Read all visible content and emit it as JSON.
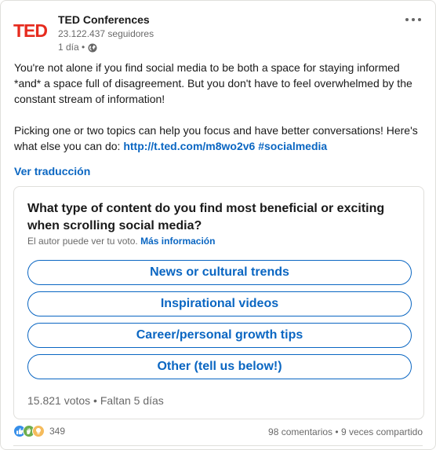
{
  "actor": {
    "logo_text": "TED",
    "name": "TED Conferences",
    "followers": "23.122.437 seguidores",
    "time": "1 día •"
  },
  "commentary": {
    "paragraph1": "You're not alone if you find social media to be both a space for staying informed *and* a space full of disagreement. But you don't have to feel overwhelmed by the constant stream of information!",
    "paragraph2_text": "Picking one or two topics can help you focus and have better conversations! Here's what else you can do:",
    "link": "http://t.ted.com/m8wo2v6",
    "hashtag": "#socialmedia"
  },
  "translate_label": "Ver traducción",
  "poll": {
    "question": "What type of content do you find most beneficial or exciting when scrolling social media?",
    "note": "El autor puede ver tu voto.",
    "more_info": "Más información",
    "options": [
      "News or cultural trends",
      "Inspirational videos",
      "Career/personal growth tips",
      "Other (tell us below!)"
    ],
    "meta": "15.821 votos • Faltan 5 días"
  },
  "social": {
    "reaction_count": "349",
    "comments": "98 comentarios",
    "separator": " • ",
    "shares": "9 veces compartido"
  },
  "colors": {
    "ted_red": "#e62b1e",
    "link_blue": "#0a66c2"
  },
  "icons": [
    "more-icon",
    "globe-icon",
    "like-reaction-icon",
    "celebrate-reaction-icon",
    "insightful-reaction-icon"
  ]
}
